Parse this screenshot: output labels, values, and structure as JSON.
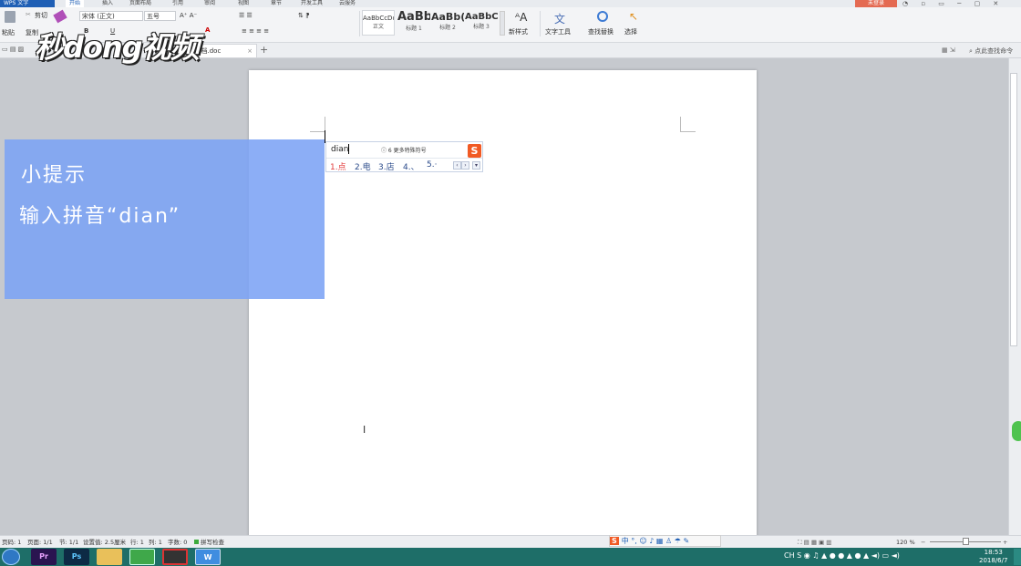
{
  "app": {
    "menu_label": "WPS 文字",
    "login_label": "未登录",
    "window_controls": "◔ ▫ ▭ ─ ▢ ✕"
  },
  "menu_tabs": [
    {
      "label": "开始",
      "active": true
    },
    {
      "label": "插入"
    },
    {
      "label": "页面布局"
    },
    {
      "label": "引用"
    },
    {
      "label": "审阅"
    },
    {
      "label": "视图"
    },
    {
      "label": "章节"
    },
    {
      "label": "开发工具"
    },
    {
      "label": "云服务"
    }
  ],
  "ribbon": {
    "paste_label": "粘贴",
    "cut_label": "剪切",
    "copy_label": "复制",
    "format_painter_label": "格式刷",
    "font_name": "宋体 (正文)",
    "font_size": "五号",
    "styles": [
      {
        "preview": "AaBbCcDd",
        "name": "正文"
      },
      {
        "preview": "AaBb",
        "name": "标题 1"
      },
      {
        "preview": "AaBb(",
        "name": "标题 2"
      },
      {
        "preview": "AaBbC",
        "name": "标题 3"
      }
    ],
    "new_style_label": "新样式",
    "text_tools_label": "文字工具",
    "find_replace_label": "查找替换",
    "select_label": "选择",
    "search_command_label": "点此查找命令"
  },
  "document_tab": {
    "title": "DC 文档.doc",
    "add_label": "+"
  },
  "watermark": {
    "text": "秒dong视频"
  },
  "tip": {
    "title": "小提示",
    "body": "输入拼音“dian”"
  },
  "ime": {
    "input": "dian",
    "hint": "ⓘ 6 更多特殊符号",
    "logo": "S",
    "candidates": [
      "1.点",
      "2.电",
      "3.店",
      "4.、",
      "5.·"
    ]
  },
  "status_bar": {
    "page_num": "页码: 1",
    "pages": "页面: 1/1",
    "section": "节: 1/1",
    "setting": "设置值: 2.5厘米",
    "row": "行: 1",
    "col": "列: 1",
    "words": "字数: 0",
    "spell": "拼写检查",
    "zoom": "120 %"
  },
  "ime_toolbar": {
    "logo": "S",
    "text": "中 °, ☺ ♪ ▦ ♙ ☂ ✎"
  },
  "taskbar": {
    "apps": [
      "Pr",
      "Ps",
      "",
      "",
      "",
      "W"
    ],
    "time": "18:53",
    "date": "2018/6/7"
  }
}
